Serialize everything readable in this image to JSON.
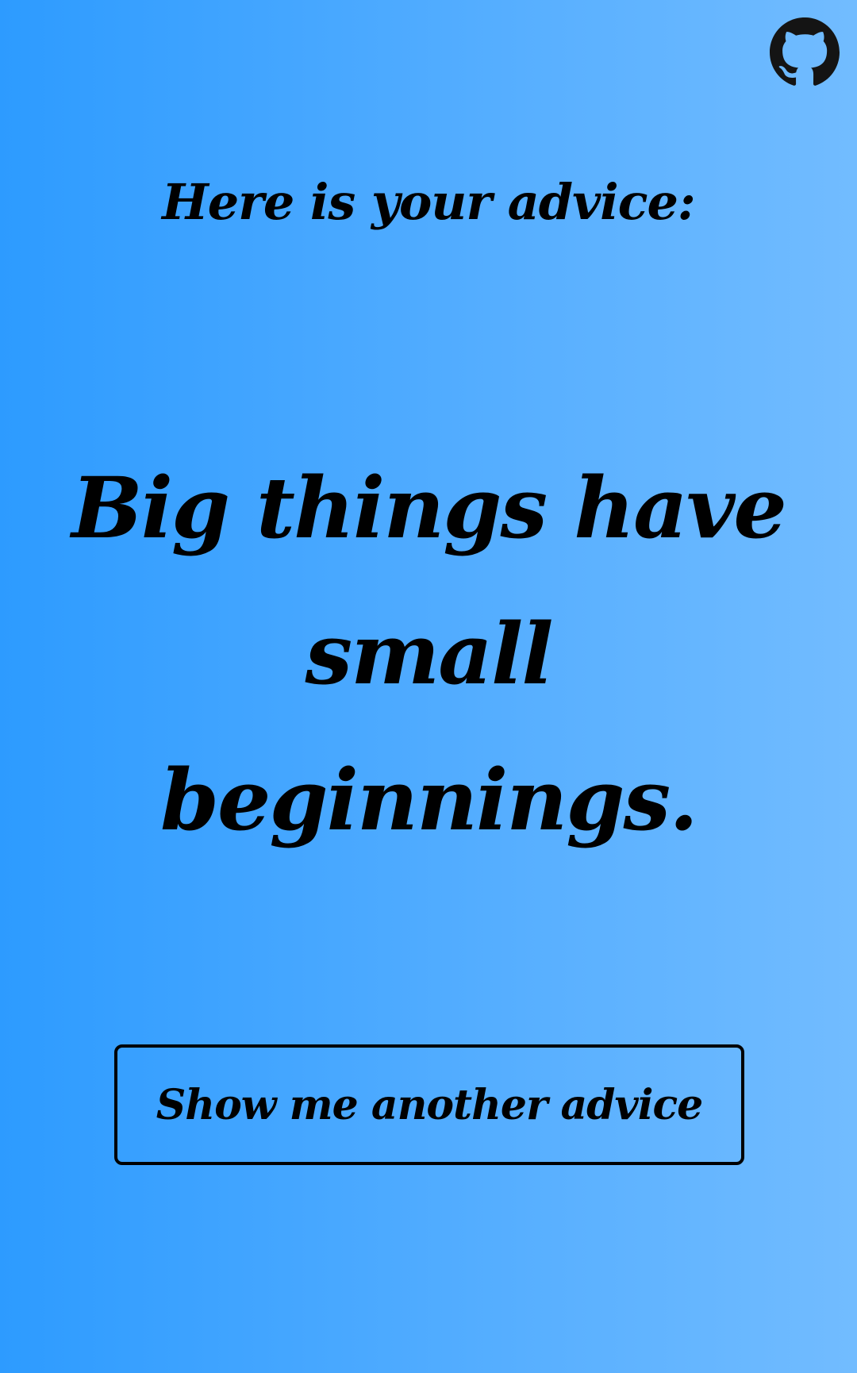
{
  "header": {
    "github_icon": "github-icon"
  },
  "main": {
    "heading": "Here is your advice:",
    "advice_text": "Big things have small beginnings.",
    "button_label": "Show me another advice"
  },
  "colors": {
    "background_start": "#2d9bff",
    "background_end": "#72bcff",
    "text": "#000000"
  }
}
